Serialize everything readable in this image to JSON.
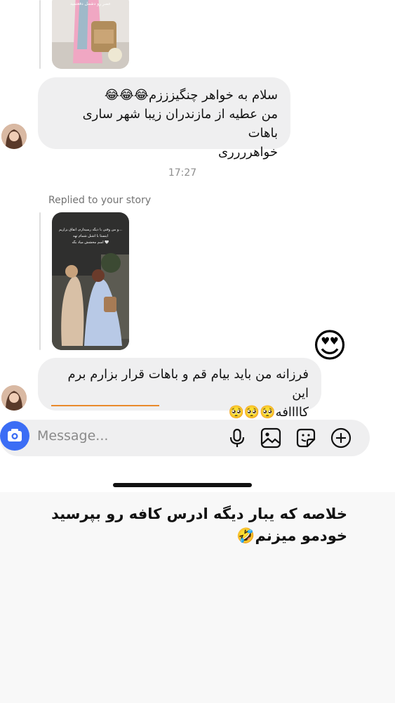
{
  "messages": [
    {
      "lines": [
        "سلام به خواهر چنگیزززم😂😂😂",
        "من عطیه از مازندران زیبا شهر ساری باهات",
        "خواهرررری"
      ]
    },
    {
      "lines": [
        "فرزانه من باید بیام قم و باهات قرار بزارم برم این",
        "کاااافه🥺🥺🥺"
      ]
    }
  ],
  "timestamp": "17:27",
  "reply_label": "Replied to your story",
  "story_text_lines": [
    "و من وقتی با دیگه رسیدازم، اتفاق بزاریم...",
    "اینستا با اشنل شمام تهه",
    "اسم محشش میاد بگه 🤍"
  ],
  "top_story_text": "عصر رو دشمل دفعتمید",
  "composer": {
    "placeholder": "Message..."
  },
  "caption_lines": [
    "خلاصه که یبار دیگه ادرس کافه رو بپرسید",
    "خودمو میزنم🤣"
  ],
  "reaction": "😍",
  "colors": {
    "accent_blue": "#3b6df5",
    "bubble_bg": "#efeff0",
    "underline": "#e98a2b"
  }
}
